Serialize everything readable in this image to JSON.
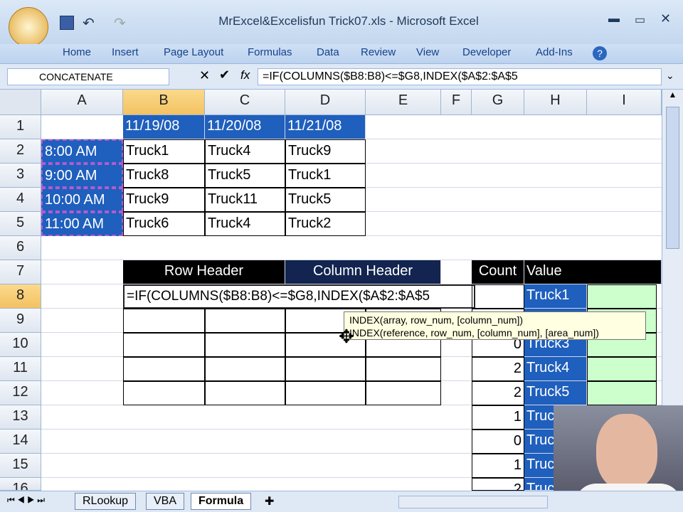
{
  "window": {
    "title": "MrExcel&Excelisfun Trick07.xls - Microsoft Excel"
  },
  "ribbon_tabs": [
    "Home",
    "Insert",
    "Page Layout",
    "Formulas",
    "Data",
    "Review",
    "View",
    "Developer",
    "Add-Ins"
  ],
  "formula_bar": {
    "name_box": "CONCATENATE",
    "fx": "fx",
    "formula": "=IF(COLUMNS($B8:B8)<=$G8,INDEX($A$2:$A$5"
  },
  "columns": [
    "A",
    "B",
    "C",
    "D",
    "E",
    "F",
    "G",
    "H",
    "I"
  ],
  "rows": [
    "1",
    "2",
    "3",
    "4",
    "5",
    "6",
    "7",
    "8",
    "9",
    "10",
    "11",
    "12",
    "13",
    "14",
    "15",
    "16"
  ],
  "grid": {
    "dates": [
      "11/19/08",
      "11/20/08",
      "11/21/08"
    ],
    "times": [
      "8:00 AM",
      "9:00 AM",
      "10:00 AM",
      "11:00 AM"
    ],
    "trucks": [
      [
        "Truck1",
        "Truck4",
        "Truck9"
      ],
      [
        "Truck8",
        "Truck5",
        "Truck1"
      ],
      [
        "Truck9",
        "Truck11",
        "Truck5"
      ],
      [
        "Truck6",
        "Truck4",
        "Truck2"
      ]
    ],
    "row_header": "Row Header",
    "column_header": "Column Header",
    "count_header": "Count",
    "value_header": "Value",
    "edit_formula": "=IF(COLUMNS($B8:B8)<=$G8,INDEX($A$2:$A$5",
    "counts": [
      "",
      "",
      "0",
      "2",
      "2",
      "1",
      "0",
      "1",
      "2"
    ],
    "values": [
      "Truck1",
      "",
      "Truck3",
      "Truck4",
      "Truck5",
      "Truck",
      "Truck",
      "Truck",
      "Truck"
    ]
  },
  "tooltip": {
    "line1": "INDEX(array, row_num, [column_num])",
    "line2": "INDEX(reference, row_num, [column_num], [area_num])"
  },
  "sheet_tabs": [
    "RLookup",
    "VBA",
    "Formula"
  ]
}
